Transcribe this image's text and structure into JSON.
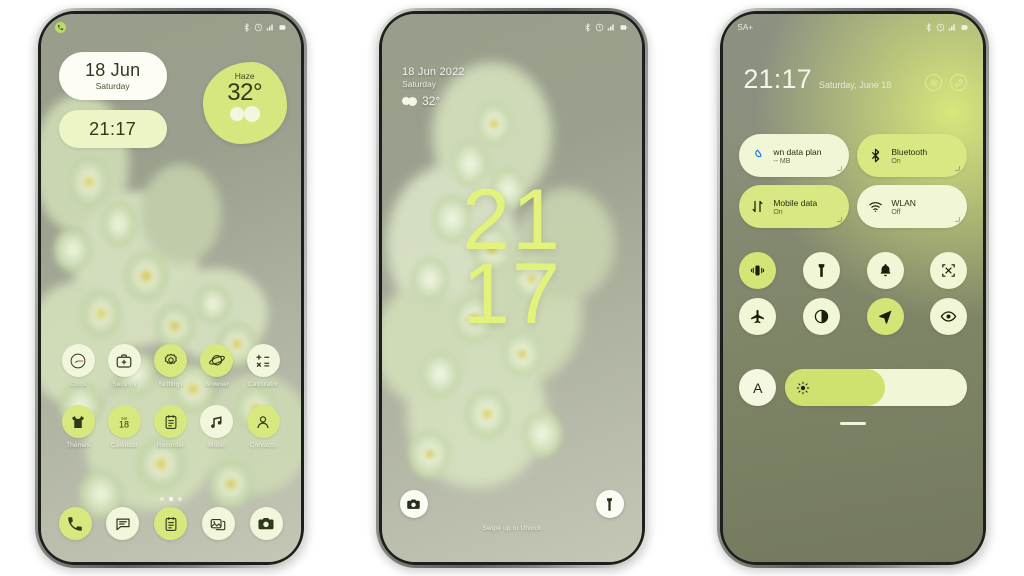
{
  "theme": {
    "accent_lime": "#d7e87f",
    "accent_cream": "#f1f6dd",
    "clock_green": "#e3f27a",
    "text_dark": "#2f3a19",
    "wallpaper_sage": "#9aa08d"
  },
  "phone_home": {
    "statusbar": {
      "notification_icon": "phone-call-icon",
      "icons": [
        "bluetooth-icon",
        "alarm-icon",
        "signal-icon",
        "battery-icon"
      ]
    },
    "date_widget": {
      "date": "18 Jun",
      "day": "Saturday"
    },
    "clock_widget": {
      "time": "21:17"
    },
    "weather_widget": {
      "condition": "Haze",
      "temperature": "32°",
      "icon": "cloud-icon"
    },
    "apps": [
      [
        {
          "label": "Clock",
          "icon": "clock-icon",
          "style": "cream"
        },
        {
          "label": "Security",
          "icon": "security-icon",
          "style": "cream"
        },
        {
          "label": "Settings",
          "icon": "gear-icon",
          "style": "lime"
        },
        {
          "label": "Browser",
          "icon": "browser-icon",
          "style": "lime"
        },
        {
          "label": "Calculator",
          "icon": "calculator-icon",
          "style": "cream"
        }
      ],
      [
        {
          "label": "Themes",
          "icon": "themes-icon",
          "style": "lime"
        },
        {
          "label": "Calendar",
          "icon": "calendar-icon",
          "style": "lime"
        },
        {
          "label": "Recorder",
          "icon": "recorder-icon",
          "style": "lime"
        },
        {
          "label": "Music",
          "icon": "music-icon",
          "style": "cream"
        },
        {
          "label": "Contacts",
          "icon": "contacts-icon",
          "style": "lime"
        }
      ]
    ],
    "page_dots": {
      "count": 3,
      "active_index": 1
    },
    "dock": [
      {
        "name": "Phone",
        "icon": "phone-icon",
        "style": "lime"
      },
      {
        "name": "Messages",
        "icon": "message-icon",
        "style": "cream"
      },
      {
        "name": "Notes",
        "icon": "notes-icon",
        "style": "lime"
      },
      {
        "name": "Gallery",
        "icon": "gallery-icon",
        "style": "cream"
      },
      {
        "name": "Camera",
        "icon": "camera-icon",
        "style": "cream"
      }
    ]
  },
  "phone_lock": {
    "statusbar": {
      "icons": [
        "bluetooth-icon",
        "alarm-icon",
        "signal-icon",
        "battery-icon"
      ]
    },
    "date": "18 Jun 2022",
    "day": "Saturday",
    "temperature": "32°",
    "weather_icon": "cloud-icon",
    "clock_hours": "21",
    "clock_minutes": "17",
    "shortcut_left": {
      "name": "Camera",
      "icon": "camera-icon"
    },
    "shortcut_right": {
      "name": "Flashlight",
      "icon": "flashlight-icon"
    },
    "unlock_hint": "Swipe up to Unlock"
  },
  "phone_shade": {
    "statusbar": {
      "carrier": "SA+",
      "icons": [
        "bluetooth-icon",
        "alarm-icon",
        "signal-icon",
        "battery-icon"
      ]
    },
    "clock": "21:17",
    "date": "Saturday, June 18",
    "header_actions": [
      {
        "name": "settings",
        "icon": "gear-icon"
      },
      {
        "name": "edit",
        "icon": "edit-icon"
      }
    ],
    "tiles": [
      {
        "title": "wn data plan",
        "subtitle": "-- MB",
        "icon": "data-drop-icon",
        "style": "cream"
      },
      {
        "title": "Bluetooth",
        "subtitle": "On",
        "icon": "bluetooth-icon",
        "style": "lime"
      },
      {
        "title": "Mobile data",
        "subtitle": "On",
        "icon": "mobile-data-icon",
        "style": "lime"
      },
      {
        "title": "WLAN",
        "subtitle": "Off",
        "icon": "wifi-icon",
        "style": "cream"
      }
    ],
    "toggles": [
      [
        {
          "name": "Vibrate",
          "icon": "vibrate-icon",
          "state": "on"
        },
        {
          "name": "Flashlight",
          "icon": "flashlight-icon",
          "state": "off"
        },
        {
          "name": "Sound",
          "icon": "bell-icon",
          "state": "off"
        },
        {
          "name": "Screenshot",
          "icon": "screenshot-icon",
          "state": "off"
        }
      ],
      [
        {
          "name": "Airplane mode",
          "icon": "airplane-icon",
          "state": "off"
        },
        {
          "name": "Dark mode",
          "icon": "dark-mode-icon",
          "state": "off"
        },
        {
          "name": "Location",
          "icon": "location-icon",
          "state": "on"
        },
        {
          "name": "Eye comfort",
          "icon": "eye-icon",
          "state": "off"
        }
      ]
    ],
    "brightness": {
      "auto_label": "A",
      "icon": "brightness-icon",
      "percent": 55
    }
  }
}
